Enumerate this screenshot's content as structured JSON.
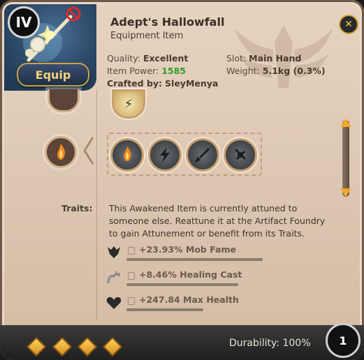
{
  "item": {
    "tier": "IV",
    "name": "Adept's Hallowfall",
    "type": "Equipment Item",
    "equip_label": "Equip"
  },
  "stats": {
    "quality_label": "Quality:",
    "quality_value": "Excellent",
    "slot_label": "Slot:",
    "slot_value": "Main Hand",
    "power_label": "Item Power:",
    "power_value": "1585",
    "weight_label": "Weight:",
    "weight_value": "5.1kg (0.3%)",
    "crafted_label": "Crafted by:",
    "crafted_value": "SleyMenya"
  },
  "traits": {
    "label": "Traits:",
    "description": "This Awakened Item is currently attuned to someone else. Reattune it at the Artifact Foundry to gain Attunement or benefit from its Traits.",
    "items": [
      {
        "text": "+23.93% Mob Fame",
        "icon": "mob-fame-icon"
      },
      {
        "text": "+8.46% Healing Cast",
        "icon": "healing-cast-icon"
      },
      {
        "text": "+247.84 Max Health",
        "icon": "max-health-icon"
      }
    ]
  },
  "footer": {
    "durability": "Durability: 100%",
    "stack_count": "1",
    "enchant_gems": 4
  },
  "colors": {
    "accent_gold": "#f2a82c",
    "power_green": "#2e9c2e",
    "panel_bg": "#dcc6b1"
  }
}
